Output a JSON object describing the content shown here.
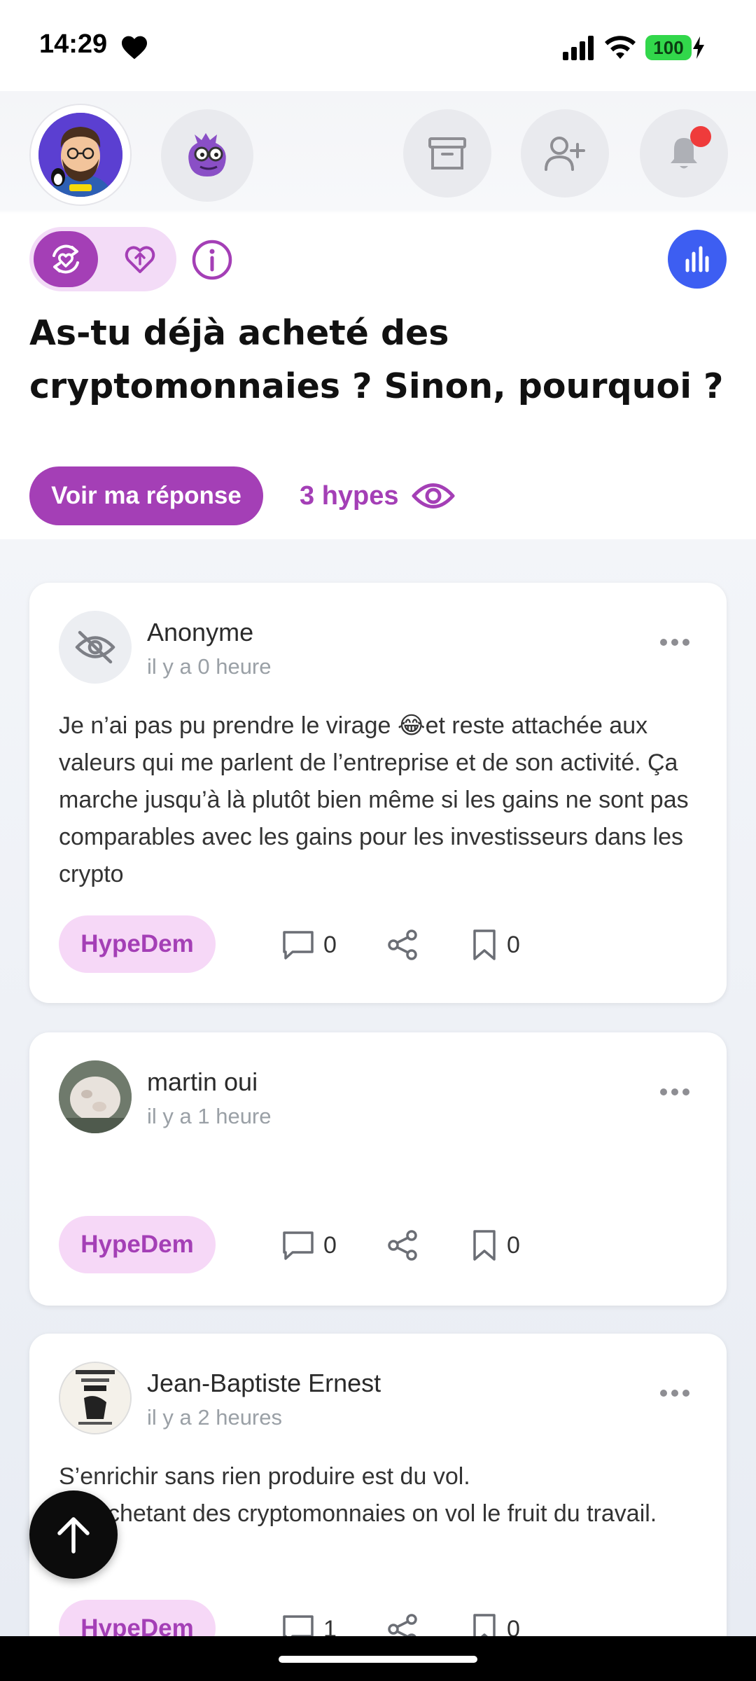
{
  "status_bar": {
    "time": "14:29",
    "battery": "100",
    "icons": [
      "heart-icon",
      "signal-icon",
      "wifi-icon",
      "battery-icon",
      "charging-icon"
    ]
  },
  "header": {
    "icons": [
      "avatar-linux",
      "avatar-dragon",
      "archive-icon",
      "add-user-icon",
      "bell-icon"
    ],
    "notification_dot_color": "#ef3b3b"
  },
  "mode_toggle": {
    "active": "refresh-heart-icon",
    "inactive": "heart-upload-icon"
  },
  "question": {
    "title": "As-tu déjà acheté des cryptomonnaies ? Sinon, pourquoi ?",
    "see_answer_label": "Voir ma réponse",
    "hypes_label": "3 hypes"
  },
  "posts": [
    {
      "author": "Anonyme",
      "time": "il y a 0 heure",
      "text": "Je n’ai pas pu prendre le virage 😂et reste attachée aux valeurs qui me parlent de l’entreprise et de son activité. Ça marche jusqu’à là plutôt bien même si les gains ne sont pas comparables avec les gains pour les investisseurs dans les crypto",
      "hype_label": "HypeDem",
      "comments": "0",
      "saves": "0"
    },
    {
      "author": "martin oui",
      "time": "il y a 1 heure",
      "text": "",
      "hype_label": "HypeDem",
      "comments": "0",
      "saves": "0"
    },
    {
      "author": "Jean-Baptiste Ernest",
      "time": "il y a 2 heures",
      "text": "S’enrichir sans rien produire est du vol.\nEn achetant des cryptomonnaies on vol le fruit du travail.",
      "hype_label": "HypeDem",
      "comments": "1",
      "saves": "0"
    }
  ],
  "colors": {
    "accent": "#a43fb6",
    "accent_light": "#f6d8f7",
    "stats_blue": "#3d5ef2"
  }
}
